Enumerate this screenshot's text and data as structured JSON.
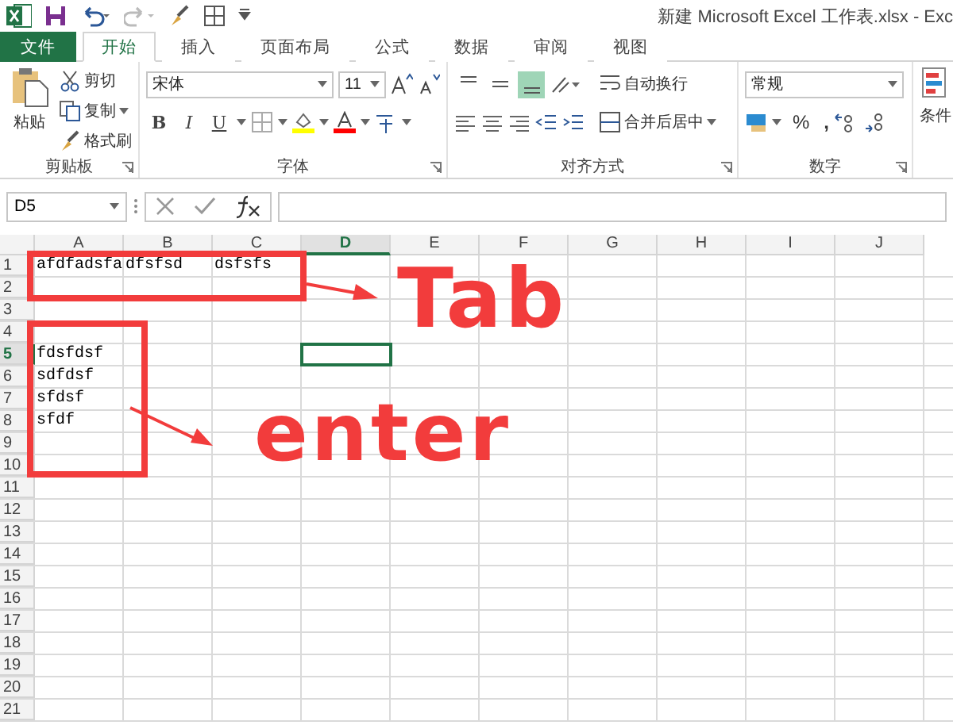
{
  "window": {
    "title": "新建 Microsoft Excel 工作表.xlsx - Exc"
  },
  "tabs": [
    {
      "label": "文件",
      "kind": "file",
      "selected": false
    },
    {
      "label": "开始",
      "kind": "tab",
      "selected": true
    },
    {
      "label": "插入",
      "kind": "tab",
      "selected": false
    },
    {
      "label": "页面布局",
      "kind": "tab",
      "selected": false
    },
    {
      "label": "公式",
      "kind": "tab",
      "selected": false
    },
    {
      "label": "数据",
      "kind": "tab",
      "selected": false
    },
    {
      "label": "审阅",
      "kind": "tab",
      "selected": false
    },
    {
      "label": "视图",
      "kind": "tab",
      "selected": false
    }
  ],
  "clipboard": {
    "paste": "粘贴",
    "cut": "剪切",
    "copy": "复制",
    "format_painter": "格式刷",
    "label": "剪贴板"
  },
  "font": {
    "name": "宋体",
    "size": "11",
    "bold": "B",
    "italic": "I",
    "underline": "U",
    "label": "字体"
  },
  "alignment": {
    "vertical": [
      {
        "selected": false
      },
      {
        "selected": false
      },
      {
        "selected": true
      }
    ],
    "wrap": "自动换行",
    "merge": "合并后居中",
    "label": "对齐方式"
  },
  "number": {
    "format": "常规",
    "percent": "%",
    "comma": ",",
    "label": "数字"
  },
  "styles": {
    "conditional": "条件"
  },
  "formula_bar": {
    "name_box": "D5"
  },
  "columns": [
    {
      "label": "A",
      "selected": false
    },
    {
      "label": "B",
      "selected": false
    },
    {
      "label": "C",
      "selected": false
    },
    {
      "label": "D",
      "selected": true
    },
    {
      "label": "E",
      "selected": false
    },
    {
      "label": "F",
      "selected": false
    },
    {
      "label": "G",
      "selected": false
    },
    {
      "label": "H",
      "selected": false
    },
    {
      "label": "I",
      "selected": false
    },
    {
      "label": "J",
      "selected": false
    }
  ],
  "rows": [
    {
      "label": "1",
      "selected": false,
      "cells": [
        "afdfadsfa",
        "dfsfsd",
        "dsfsfs"
      ]
    },
    {
      "label": "2",
      "selected": false,
      "cells": []
    },
    {
      "label": "3",
      "selected": false,
      "cells": []
    },
    {
      "label": "4",
      "selected": false,
      "cells": []
    },
    {
      "label": "5",
      "selected": true,
      "cells": [
        "fdsfdsf"
      ]
    },
    {
      "label": "6",
      "selected": false,
      "cells": [
        "sdfdsf"
      ]
    },
    {
      "label": "7",
      "selected": false,
      "cells": [
        "sfdsf"
      ]
    },
    {
      "label": "8",
      "selected": false,
      "cells": [
        "sfdf"
      ]
    },
    {
      "label": "9",
      "selected": false,
      "cells": []
    },
    {
      "label": "10",
      "selected": false,
      "cells": []
    },
    {
      "label": "11",
      "selected": false,
      "cells": []
    },
    {
      "label": "12",
      "selected": false,
      "cells": []
    },
    {
      "label": "13",
      "selected": false,
      "cells": []
    },
    {
      "label": "14",
      "selected": false,
      "cells": []
    },
    {
      "label": "15",
      "selected": false,
      "cells": []
    },
    {
      "label": "16",
      "selected": false,
      "cells": []
    },
    {
      "label": "17",
      "selected": false,
      "cells": []
    },
    {
      "label": "18",
      "selected": false,
      "cells": []
    },
    {
      "label": "19",
      "selected": false,
      "cells": []
    },
    {
      "label": "20",
      "selected": false,
      "cells": []
    },
    {
      "label": "21",
      "selected": false,
      "cells": []
    }
  ],
  "annotations": [
    {
      "text": "Tab",
      "kind": "tab"
    },
    {
      "text": "enter",
      "kind": "enter"
    }
  ]
}
